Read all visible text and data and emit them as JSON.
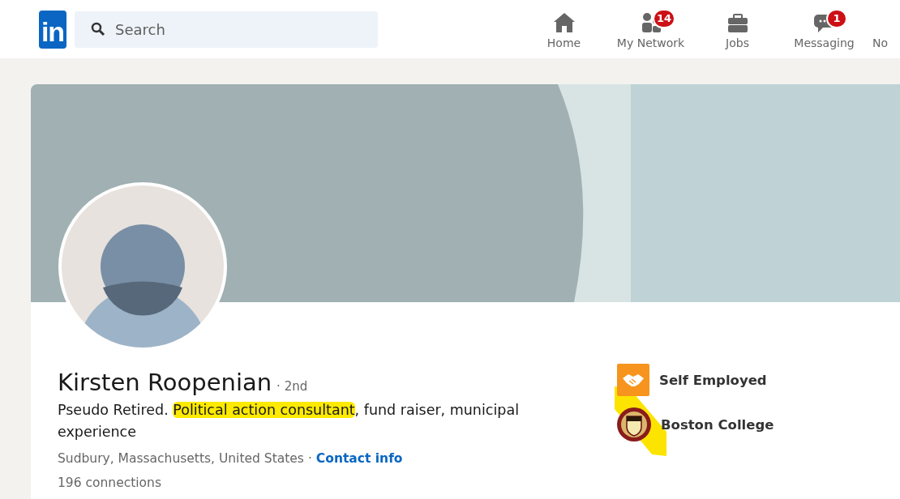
{
  "top_nav": {
    "logo": "in",
    "search": {
      "placeholder": "Search"
    },
    "items": [
      {
        "kind": "home",
        "label": "Home"
      },
      {
        "kind": "network",
        "label": "My Network",
        "badge": "14"
      },
      {
        "kind": "jobs",
        "label": "Jobs"
      },
      {
        "kind": "messaging",
        "label": "Messaging",
        "badge": "1"
      },
      {
        "kind": "notifications",
        "label": "No"
      }
    ]
  },
  "profile": {
    "name": "Kirsten Roopenian",
    "degree": "· 2nd",
    "headline": [
      {
        "text": "Pseudo Retired. ",
        "highlighted": false
      },
      {
        "text": "Political action consultant",
        "highlighted": true
      },
      {
        "text": ", fund raiser, municipal experience",
        "highlighted": false
      }
    ],
    "location": "Sudbury, Massachusetts, United States",
    "separator": "·",
    "contact_link": "Contact info",
    "connections": "196 connections",
    "affiliations": [
      {
        "kind": "company",
        "name": "Self Employed"
      },
      {
        "kind": "school",
        "name": "Boston College"
      }
    ]
  }
}
